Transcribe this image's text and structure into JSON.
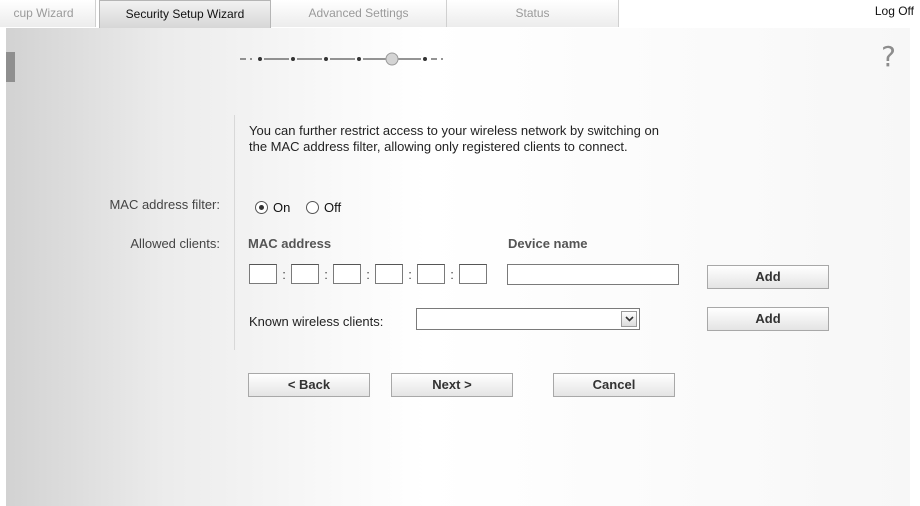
{
  "tabs": [
    {
      "label": "cup Wizard",
      "active": false
    },
    {
      "label": "Security Setup Wizard",
      "active": true
    },
    {
      "label": "Advanced Settings",
      "active": false
    },
    {
      "label": "Status",
      "active": false
    }
  ],
  "logoff_label": "Log Off",
  "help_icon": "?",
  "progress": {
    "steps": 6,
    "current_step": 5
  },
  "intro_text": "You can further restrict access to your wireless network by switching on the MAC address filter, allowing only registered clients to connect.",
  "mac_filter": {
    "label": "MAC address filter:",
    "options": [
      {
        "label": "On",
        "checked": true
      },
      {
        "label": "Off",
        "checked": false
      }
    ]
  },
  "allowed_clients": {
    "label": "Allowed clients:",
    "mac_header": "MAC address",
    "device_header": "Device name",
    "separator": ":",
    "mac_octets": [
      "",
      "",
      "",
      "",
      "",
      ""
    ],
    "device_name_value": "",
    "add_label": "Add"
  },
  "known_clients": {
    "label": "Known wireless clients:",
    "selected": "",
    "add_label": "Add"
  },
  "nav": {
    "back_label": "< Back",
    "next_label": "Next >",
    "cancel_label": "Cancel"
  },
  "colors": {
    "panel": "#f2f2f2",
    "active_tab": "#dcdcdc",
    "button": "#ececec"
  }
}
